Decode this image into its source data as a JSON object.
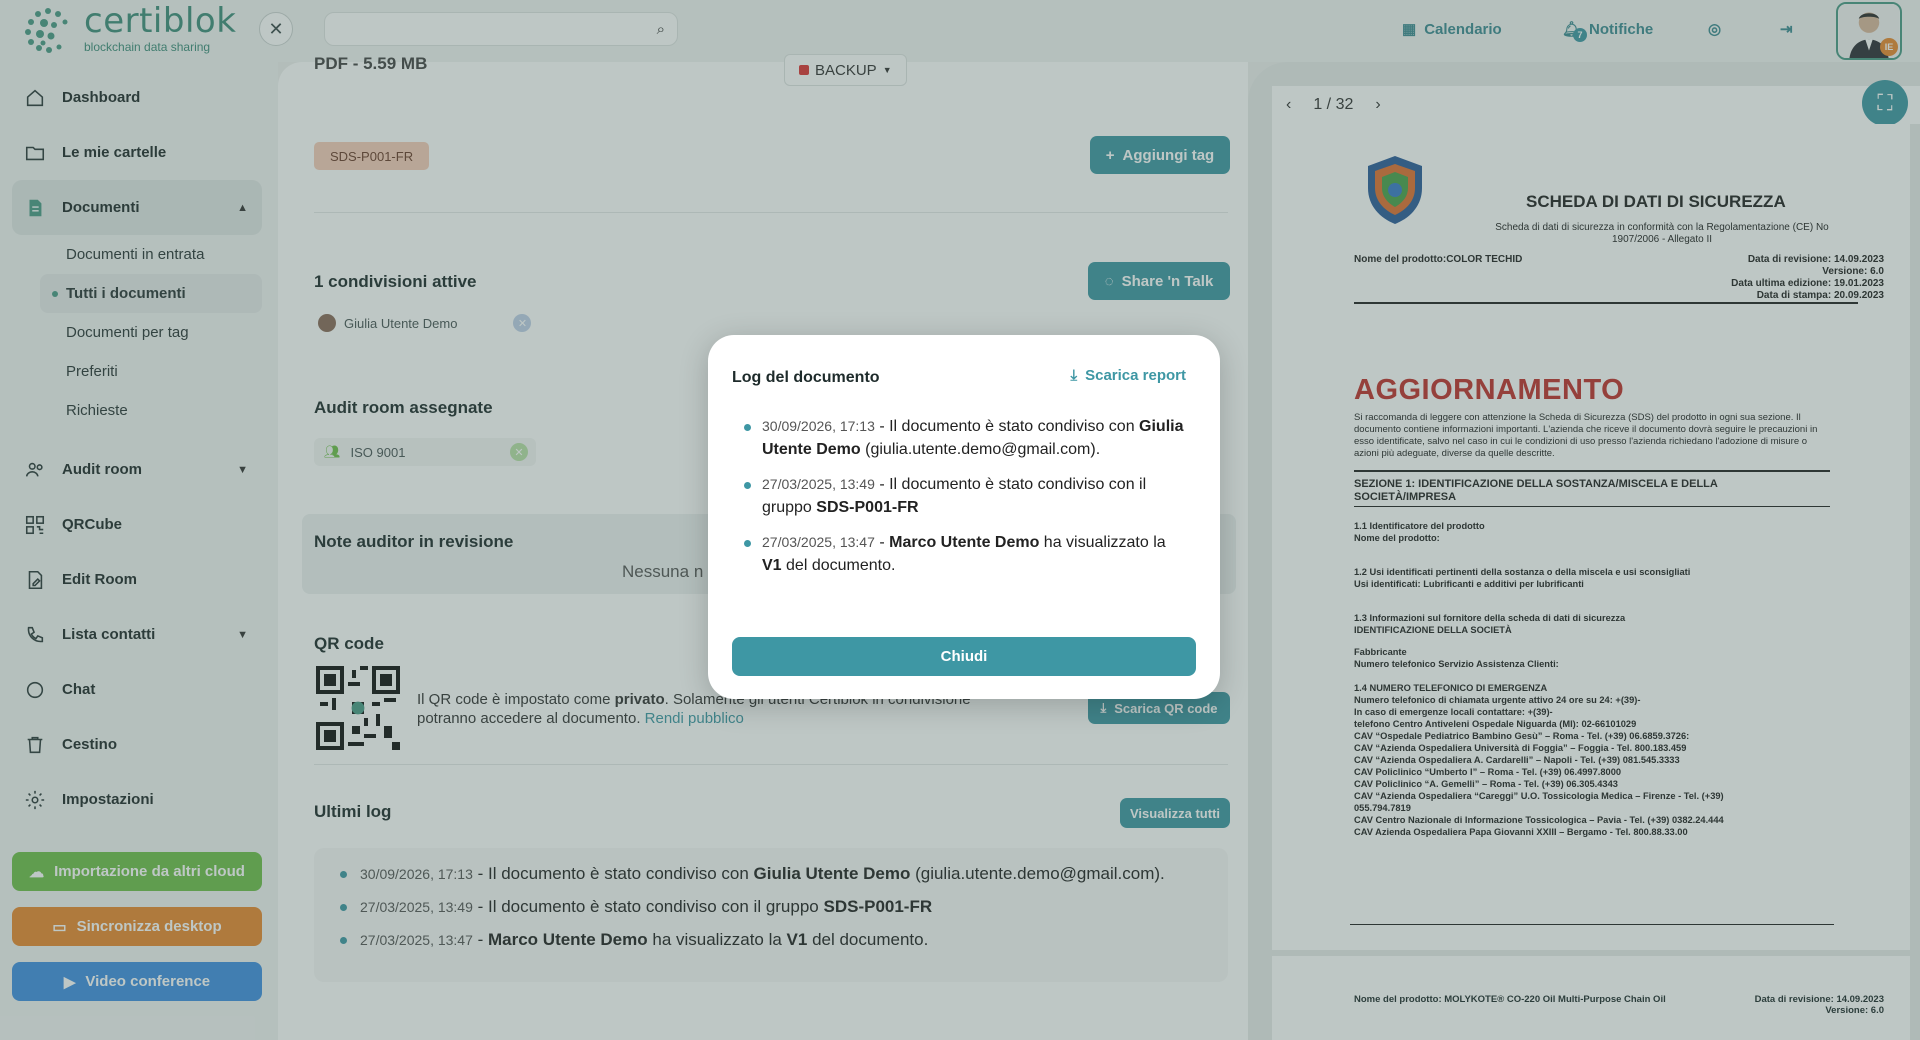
{
  "app": {
    "brand": "certiblok",
    "tagline": "blockchain data sharing"
  },
  "colors": {
    "accent": "#3e97a4",
    "brand": "#3f8e7c",
    "orange": "#e8892f",
    "green": "#6fbf4a",
    "blue": "#3f8fe0"
  },
  "topbar": {
    "calendar": "Calendario",
    "notifications": "Notifiche",
    "notif_count": "7",
    "avatar_badge": "IE"
  },
  "sidebar": {
    "items": [
      {
        "label": "Dashboard",
        "icon": "home-icon"
      },
      {
        "label": "Le mie cartelle",
        "icon": "folder-icon"
      },
      {
        "label": "Documenti",
        "icon": "document-icon"
      },
      {
        "label": "Audit room",
        "icon": "users-icon"
      },
      {
        "label": "QRCube",
        "icon": "qr-icon"
      },
      {
        "label": "Edit Room",
        "icon": "edit-icon"
      },
      {
        "label": "Lista contatti",
        "icon": "phone-icon"
      },
      {
        "label": "Chat",
        "icon": "chat-icon"
      },
      {
        "label": "Cestino",
        "icon": "trash-icon"
      },
      {
        "label": "Impostazioni",
        "icon": "gear-icon"
      }
    ],
    "sub_items": [
      "Documenti in entrata",
      "Tutti i documenti",
      "Documenti per tag",
      "Preferiti",
      "Richieste"
    ],
    "import_cloud": "Importazione da altri cloud",
    "sync_desktop": "Sincronizza desktop",
    "video": "Video conference"
  },
  "doc": {
    "file_info": "PDF - 5.59 MB",
    "backup": "BACKUP",
    "tag": "SDS-P001-FR",
    "add_tag": "Aggiungi tag",
    "shares_title": "1 condivisioni attive",
    "share_talk": "Share 'n Talk",
    "share_user": "Giulia Utente Demo",
    "audit_title": "Audit room assegnate",
    "audit_room": "ISO 9001",
    "notes_title": "Note auditor in revisione",
    "notes_empty": "Nessuna n",
    "qr_title": "QR code",
    "qr_text_1": "Il QR code è impostato come ",
    "qr_text_bold": "privato",
    "qr_text_2": ". Solamente gli utenti Certiblok in condivisione",
    "qr_text_3": "potranno accedere al documento. ",
    "qr_link": "Rendi pubblico",
    "qr_download": "Scarica QR code",
    "log_title": "Ultimi log",
    "view_all": "Visualizza tutti"
  },
  "logs": [
    {
      "ts": "30/09/2026, 17:13",
      "pre": " - Il documento è stato condiviso con ",
      "bold": "Giulia Utente Demo",
      "post": " (giulia.utente.demo@gmail.com).",
      "bold2": "",
      "post2": ""
    },
    {
      "ts": "27/03/2025, 13:49",
      "pre": " - Il documento è stato condiviso con il gruppo ",
      "bold": "SDS-P001-FR",
      "post": "",
      "bold2": "",
      "post2": ""
    },
    {
      "ts": "27/03/2025, 13:47",
      "pre": " - ",
      "bold": "Marco Utente Demo",
      "post": " ha visualizzato la ",
      "bold2": "V1",
      "post2": " del documento."
    }
  ],
  "modal": {
    "title": "Log del documento",
    "report": "Scarica report",
    "close": "Chiudi"
  },
  "pdf": {
    "page_indicator": "1 / 32",
    "title": "SCHEDA DI DATI DI SICUREZZA",
    "subtitle": "Scheda di dati di sicurezza in conformità con la Regolamentazione (CE) No 1907/2006 - Allegato II",
    "product": "Nome del prodotto:COLOR TECHID",
    "rev": "Data di revisione: 14.09.2023",
    "version": "Versione: 6.0",
    "last_ed": "Data ultima edizione: 19.01.2023",
    "print": "Data di stampa: 20.09.2023",
    "update": "AGGIORNAMENTO",
    "update_text": "Si raccomanda di leggere con attenzione la Scheda di Sicurezza (SDS) del prodotto in ogni sua sezione. Il documento contiene informazioni importanti. L'azienda che riceve il documento dovrà seguire le precauzioni in esso identificate, salvo nel caso in cui le condizioni di uso presso l'azienda richiedano l'adozione di misure o azioni più adeguate, diverse da quelle descritte.",
    "sec1": "SEZIONE 1: IDENTIFICAZIONE DELLA SOSTANZA/MISCELA E DELLA SOCIETÀ/IMPRESA",
    "lines": [
      "1.1 Identificatore del prodotto",
      "Nome del prodotto:",
      "",
      "1.2 Usi identificati pertinenti della sostanza o della miscela e usi sconsigliati",
      "Usi identificati: Lubrificanti e additivi per lubrificanti",
      "",
      "1.3 Informazioni sul fornitore della scheda di dati di sicurezza",
      "IDENTIFICAZIONE DELLA SOCIETÀ",
      "",
      "Fabbricante",
      "Numero telefonico Servizio Assistenza Clienti:",
      "",
      "1.4 NUMERO TELEFONICO DI EMERGENZA",
      "Numero telefonico di chiamata urgente attivo 24 ore su 24: +(39)-",
      "In caso di emergenze locali contattare: +(39)-",
      "telefono Centro Antiveleni Ospedale Niguarda (MI): 02-66101029",
      "CAV “Ospedale Pediatrico Bambino Gesù” – Roma - Tel. (+39) 06.6859.3726:",
      "CAV “Azienda Ospedaliera Università di Foggia” – Foggia - Tel. 800.183.459",
      "CAV “Azienda Ospedaliera A. Cardarelli” – Napoli - Tel. (+39) 081.545.3333",
      "CAV Policlinico “Umberto I” – Roma - Tel. (+39) 06.4997.8000",
      "CAV Policlinico “A. Gemelli” – Roma - Tel. (+39) 06.305.4343",
      "CAV “Azienda Ospedaliera “Careggi” U.O. Tossicologia Medica – Firenze - Tel. (+39)",
      "055.794.7819",
      "CAV Centro Nazionale di Informazione Tossicologica – Pavia - Tel. (+39) 0382.24.444",
      "CAV Azienda Ospedaliera Papa Giovanni XXIII – Bergamo - Tel. 800.88.33.00"
    ],
    "footer_product": "Nome del prodotto: MOLYKOTE® CO-220 Oil Multi-Purpose Chain Oil",
    "footer_rev": "Data di revisione: 14.09.2023",
    "footer_version": "Versione: 6.0"
  }
}
